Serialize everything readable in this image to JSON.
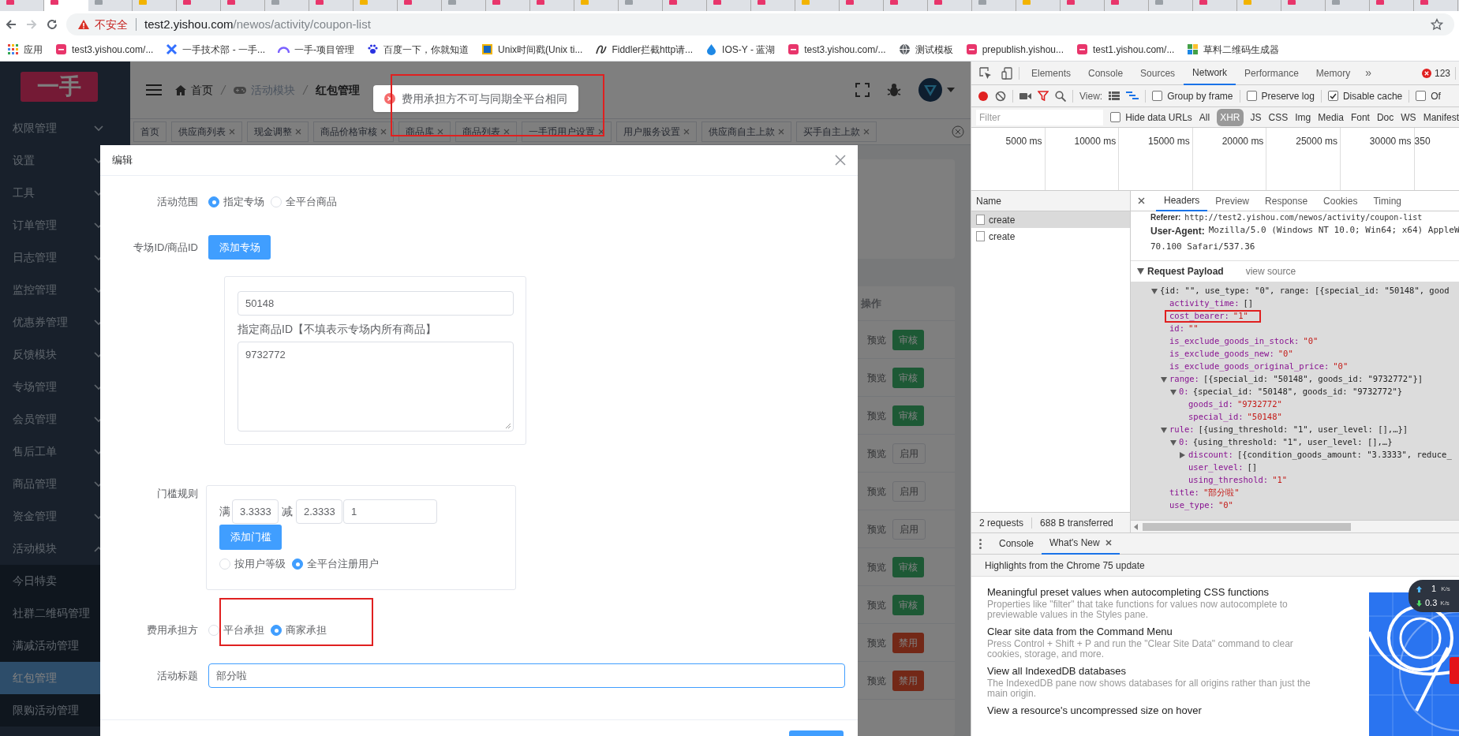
{
  "address_bar": {
    "security": "不安全",
    "host": "test2.yishou.com",
    "path": "/newos/activity/coupon-list"
  },
  "bookmarks": [
    {
      "label": "应用",
      "kind": "apps"
    },
    {
      "label": "test3.yishou.com/...",
      "kind": "pink"
    },
    {
      "label": "一手技术部 - 一手...",
      "kind": "cross"
    },
    {
      "label": "一手-项目管理",
      "kind": "arc"
    },
    {
      "label": "百度一下，你就知道",
      "kind": "paw"
    },
    {
      "label": "Unix时间戳(Unix ti...",
      "kind": "square"
    },
    {
      "label": "Fiddler拦截http请...",
      "kind": "scribble"
    },
    {
      "label": "IOS-Y - 蓝湖",
      "kind": "drop"
    },
    {
      "label": "test3.yishou.com/...",
      "kind": "pink"
    },
    {
      "label": "测试模板",
      "kind": "globe"
    },
    {
      "label": "prepublish.yishou...",
      "kind": "pink"
    },
    {
      "label": "test1.yishou.com/...",
      "kind": "pink"
    },
    {
      "label": "草料二维码生成器",
      "kind": "grid"
    }
  ],
  "app": {
    "logo": "一手",
    "sidebar": [
      {
        "label": "权限管理",
        "expanded": false
      },
      {
        "label": "设置",
        "expanded": false
      },
      {
        "label": "工具",
        "expanded": false
      },
      {
        "label": "订单管理",
        "expanded": false
      },
      {
        "label": "日志管理",
        "expanded": false
      },
      {
        "label": "监控管理",
        "expanded": false
      },
      {
        "label": "优惠券管理",
        "expanded": false
      },
      {
        "label": "反馈模块",
        "expanded": false
      },
      {
        "label": "专场管理",
        "expanded": false
      },
      {
        "label": "会员管理",
        "expanded": false
      },
      {
        "label": "售后工单",
        "expanded": false
      },
      {
        "label": "商品管理",
        "expanded": false
      },
      {
        "label": "资金管理",
        "expanded": false
      },
      {
        "label": "活动模块",
        "expanded": true,
        "children": [
          {
            "label": "今日特卖",
            "selected": false
          },
          {
            "label": "社群二维码管理",
            "selected": false
          },
          {
            "label": "满减活动管理",
            "selected": false
          },
          {
            "label": "红包管理",
            "selected": true
          },
          {
            "label": "限购活动管理",
            "selected": false
          }
        ]
      }
    ],
    "breadcrumb": [
      {
        "label": "首页",
        "kind": "home"
      },
      {
        "label": "活动模块",
        "kind": "game"
      },
      {
        "label": "红包管理",
        "kind": "current"
      }
    ],
    "toast": {
      "message": "费用承担方不可与同期全平台相同",
      "annotated": true
    },
    "tags": [
      {
        "label": "首页",
        "closable": false
      },
      {
        "label": "供应商列表",
        "closable": true
      },
      {
        "label": "现金调整",
        "closable": true
      },
      {
        "label": "商品价格审核",
        "closable": true
      },
      {
        "label": "商品库",
        "closable": true
      },
      {
        "label": "商品列表",
        "closable": true
      },
      {
        "label": "一手币用户设置",
        "closable": true
      },
      {
        "label": "用户服务设置",
        "closable": true
      },
      {
        "label": "供应商自主上款",
        "closable": true
      },
      {
        "label": "买手自主上款",
        "closable": true
      }
    ],
    "table": {
      "column": "操作",
      "rows": [
        {
          "preview": "预览",
          "action": "审核",
          "kind": "approve"
        },
        {
          "preview": "预览",
          "action": "审核",
          "kind": "approve"
        },
        {
          "preview": "预览",
          "action": "审核",
          "kind": "approve"
        },
        {
          "preview": "预览",
          "action": "启用",
          "kind": "enable"
        },
        {
          "preview": "预览",
          "action": "启用",
          "kind": "enable"
        },
        {
          "preview": "预览",
          "action": "启用",
          "kind": "enable"
        },
        {
          "preview": "预览",
          "action": "审核",
          "kind": "approve"
        },
        {
          "preview": "预览",
          "action": "审核",
          "kind": "approve"
        },
        {
          "preview": "预览",
          "action": "禁用",
          "kind": "disable"
        },
        {
          "preview": "预览",
          "action": "禁用",
          "kind": "disable"
        }
      ]
    },
    "modal": {
      "title": "编辑",
      "scope": {
        "label": "活动范围",
        "options": [
          {
            "label": "指定专场",
            "selected": true
          },
          {
            "label": "全平台商品",
            "selected": false
          }
        ]
      },
      "special": {
        "label": "专场ID/商品ID",
        "button": "添加专场",
        "special_id": "50148",
        "goods_label": "指定商品ID【不填表示专场内所有商品】",
        "goods_ids": "9732772"
      },
      "threshold": {
        "label": "门槛规则",
        "full_prefix": "满",
        "full": "3.3333",
        "reduce_prefix": "减",
        "reduce": "2.3333",
        "count": "1",
        "button": "添加门槛",
        "options": [
          {
            "label": "按用户等级",
            "selected": false
          },
          {
            "label": "全平台注册用户",
            "selected": true
          }
        ]
      },
      "cost_bearer": {
        "label": "费用承担方",
        "annotated": true,
        "options": [
          {
            "label": "平台承担",
            "selected": false
          },
          {
            "label": "商家承担",
            "selected": true
          }
        ]
      },
      "title_field": {
        "label": "活动标题",
        "value": "部分啦",
        "focused": true
      }
    }
  },
  "devtools": {
    "panels": [
      {
        "label": "Elements",
        "selected": false
      },
      {
        "label": "Console",
        "selected": false
      },
      {
        "label": "Sources",
        "selected": false
      },
      {
        "label": "Network",
        "selected": true
      },
      {
        "label": "Performance",
        "selected": false
      },
      {
        "label": "Memory",
        "selected": false
      }
    ],
    "more": "»",
    "error_count": "123",
    "toolbar": {
      "view_label": "View:",
      "checkboxes": [
        {
          "label": "Group by frame",
          "checked": false
        },
        {
          "label": "Preserve log",
          "checked": false
        },
        {
          "label": "Disable cache",
          "checked": true
        },
        {
          "label": "Of",
          "checked": false
        }
      ]
    },
    "filter": {
      "placeholder": "Filter",
      "hide_data_urls": {
        "label": "Hide data URLs",
        "checked": false
      },
      "types": [
        {
          "label": "All",
          "selected": false
        },
        {
          "label": "XHR",
          "selected": true
        },
        {
          "label": "JS",
          "selected": false
        },
        {
          "label": "CSS",
          "selected": false
        },
        {
          "label": "Img",
          "selected": false
        },
        {
          "label": "Media",
          "selected": false
        },
        {
          "label": "Font",
          "selected": false
        },
        {
          "label": "Doc",
          "selected": false
        },
        {
          "label": "WS",
          "selected": false
        },
        {
          "label": "Manifest",
          "selected": false
        }
      ]
    },
    "overview_ticks": [
      "5000 ms",
      "10000 ms",
      "15000 ms",
      "20000 ms",
      "25000 ms",
      "30000 ms",
      "350"
    ],
    "requests": {
      "header": "Name",
      "rows": [
        {
          "name": "create",
          "selected": true
        },
        {
          "name": "create",
          "selected": false
        }
      ]
    },
    "detail_tabs": [
      {
        "label": "Headers",
        "selected": true
      },
      {
        "label": "Preview",
        "selected": false
      },
      {
        "label": "Response",
        "selected": false
      },
      {
        "label": "Cookies",
        "selected": false
      },
      {
        "label": "Timing",
        "selected": false
      }
    ],
    "headers": [
      {
        "name": "Referer:",
        "lines": [
          "http://test2.yishou.com/newos/activity/coupon-list"
        ]
      },
      {
        "name": "User-Agent:",
        "lines": [
          "Mozilla/5.0 (Windows NT 10.0; Win64; x64) AppleW",
          "70.100 Safari/537.36"
        ]
      }
    ],
    "payload": {
      "title": "Request Payload",
      "view_source": "view source",
      "tree": {
        "preview": "{id: \"\", use_type: \"0\", range: [{special_id: \"50148\", good",
        "expanded": true,
        "children": [
          {
            "key": "activity_time:",
            "value": "[]",
            "kind": "array"
          },
          {
            "key": "cost_bearer:",
            "value": "\"1\"",
            "kind": "string",
            "annotated": true
          },
          {
            "key": "id:",
            "value": "\"\"",
            "kind": "string"
          },
          {
            "key": "is_exclude_goods_in_stock:",
            "value": "\"0\"",
            "kind": "string"
          },
          {
            "key": "is_exclude_goods_new:",
            "value": "\"0\"",
            "kind": "string"
          },
          {
            "key": "is_exclude_goods_original_price:",
            "value": "\"0\"",
            "kind": "string"
          },
          {
            "key": "range:",
            "preview": "[{special_id: \"50148\", goods_id: \"9732772\"}]",
            "expanded": true,
            "children": [
              {
                "key": "0:",
                "preview": "{special_id: \"50148\", goods_id: \"9732772\"}",
                "expanded": true,
                "children": [
                  {
                    "key": "goods_id:",
                    "value": "\"9732772\"",
                    "kind": "string"
                  },
                  {
                    "key": "special_id:",
                    "value": "\"50148\"",
                    "kind": "string"
                  }
                ]
              }
            ]
          },
          {
            "key": "rule:",
            "preview": "[{using_threshold: \"1\", user_level: [],…}]",
            "expanded": true,
            "children": [
              {
                "key": "0:",
                "preview": "{using_threshold: \"1\", user_level: [],…}",
                "expanded": true,
                "children": [
                  {
                    "key": "discount:",
                    "preview": "[{condition_goods_amount: \"3.3333\", reduce_",
                    "expanded": false
                  },
                  {
                    "key": "user_level:",
                    "value": "[]",
                    "kind": "array"
                  },
                  {
                    "key": "using_threshold:",
                    "value": "\"1\"",
                    "kind": "string"
                  }
                ]
              }
            ]
          },
          {
            "key": "title:",
            "value": "\"部分啦\"",
            "kind": "string"
          },
          {
            "key": "use_type:",
            "value": "\"0\"",
            "kind": "string"
          }
        ]
      }
    },
    "status": [
      "2 requests",
      "688 B transferred"
    ],
    "drawer": {
      "tabs": [
        {
          "label": "Console",
          "selected": false,
          "closable": false
        },
        {
          "label": "What's New",
          "selected": true,
          "closable": true
        }
      ],
      "heading": "Highlights from the Chrome 75 update",
      "items": [
        {
          "title": "Meaningful preset values when autocompleting CSS functions",
          "description": "Properties like \"filter\" that take functions for values now autocomplete to previewable values in the Styles pane."
        },
        {
          "title": "Clear site data from the Command Menu",
          "description": "Press Control + Shift + P and run the \"Clear Site Data\" command to clear cookies, storage, and more."
        },
        {
          "title": "View all IndexedDB databases",
          "description": "The IndexedDB pane now shows databases for all origins rather than just the main origin."
        },
        {
          "title": "View a resource's uncompressed size on hover"
        }
      ],
      "speed": {
        "up": "1",
        "up_unit": "K/s",
        "down": "0.3",
        "down_unit": "K/s"
      }
    }
  }
}
